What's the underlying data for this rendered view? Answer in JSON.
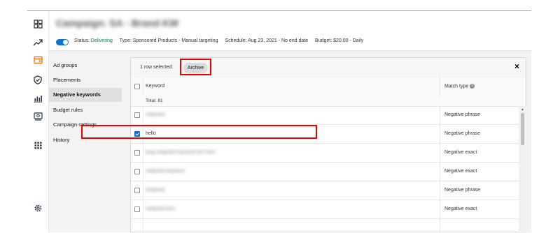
{
  "campaign": {
    "title": "Campaign: SA - Brand KW",
    "status_label": "Status:",
    "status_value": "Delivering",
    "type_text": "Type: Sponsored Products - Manual targeting",
    "schedule_text": "Schedule: Aug 23, 2021 - No end date",
    "budget_text": "Budget: $20.00 - Daily"
  },
  "rail_icons": [
    "dashboard-icon",
    "trend-icon",
    "campaign-icon",
    "shield-icon",
    "bar-chart-icon",
    "gallery-icon",
    "apps-grid-icon",
    "settings-icon"
  ],
  "subnav": {
    "items": [
      {
        "label": "Ad groups"
      },
      {
        "label": "Placements"
      },
      {
        "label": "Negative keywords"
      },
      {
        "label": "Budget rules"
      },
      {
        "label": "Campaign settings"
      },
      {
        "label": "History"
      }
    ],
    "active": "Negative keywords"
  },
  "panel": {
    "selected_text": "1 row selected:",
    "archive_label": "Archive",
    "close_symbol": "×"
  },
  "table": {
    "col_keyword": "Keyword",
    "col_match": "Match type",
    "info_symbol": "i",
    "total": "Total: 81",
    "rows": [
      {
        "keyword": "redacted",
        "match": "Negative phrase",
        "checked": false
      },
      {
        "keyword": "hello",
        "match": "Negative phrase",
        "checked": true
      },
      {
        "keyword": "long redacted keyword text here",
        "match": "Negative exact",
        "checked": false
      },
      {
        "keyword": "redacted keyword",
        "match": "Negative exact",
        "checked": false
      },
      {
        "keyword": "redacted",
        "match": "Negative phrase",
        "checked": false
      },
      {
        "keyword": "redacted item",
        "match": "Negative exact",
        "checked": false
      }
    ]
  },
  "colors": {
    "accent": "#0972d3",
    "status_green": "#067d62",
    "highlight": "#e00",
    "top_line": "#f28b30"
  }
}
